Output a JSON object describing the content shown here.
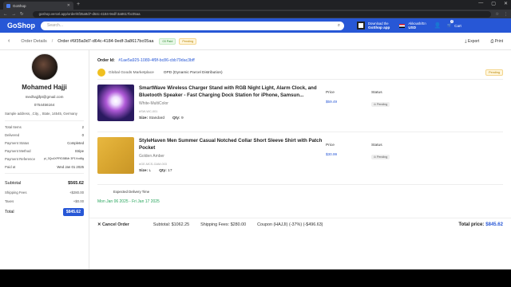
{
  "browser": {
    "tab_title": "GoShop",
    "url": "goshop.vercel.app/order/6f35a9d7-d64c-4184-9edf-3a8617bc05aa"
  },
  "header": {
    "logo": "GoShop",
    "search_placeholder": "Search...",
    "download_title": "Download the",
    "download_sub": "GoShop app",
    "user_line1": "Akkoush/En",
    "user_line2": "USD",
    "cart_count": "0",
    "cart_label": "Cart"
  },
  "orderbar": {
    "crumb_root": "Order Details",
    "crumb_current": "Order #6f35a9d7-d64c-4184-9edf-3a8617bc05aa",
    "paid_badge": "03 Paid",
    "pending_badge": "Pending",
    "export_label": "Export",
    "print_label": "Print"
  },
  "customer": {
    "name": "Mohamed Hajji",
    "email": "medhajjifpt@gmail.com",
    "phone": "0754456164",
    "address": "Sample address, ,City, , State, 14545, Germany"
  },
  "summary": {
    "rows": [
      {
        "k": "Total Items",
        "v": "2"
      },
      {
        "k": "Delivered",
        "v": "0"
      },
      {
        "k": "Payment Status",
        "v": "Completed"
      },
      {
        "k": "Payment Method",
        "v": "Stripe"
      },
      {
        "k": "Payment Reference",
        "v": "pi_3Qc4XPFfD5BMr 3P1Vcd8g"
      },
      {
        "k": "Paid at",
        "v": "Wed Jan 01 2025"
      }
    ],
    "subtotal_label": "Subtotal",
    "subtotal": "$565.62",
    "shipping_label": "Shipping Fees",
    "shipping": "+$280.00",
    "taxes_label": "Taxes",
    "taxes": "+$0.00",
    "total_label": "Total",
    "total": "$845.62"
  },
  "order": {
    "id_label": "Order Id:",
    "id": "#1ae5a925-1089-4f9f-bc86-cbb79dac3bff",
    "seller": "Global Goods Marketplace",
    "shipping_method": "OPD (Dynamic Parcel Distribution)",
    "seller_status": "Pending",
    "price_header": "Price",
    "status_header": "Status",
    "items": [
      {
        "title": "SmartWave Wireless Charger Stand with RGB Night Light, Alarm Clock, and Bluetooth Speaker - Fast Charging Dock Station for iPhone, Samsun...",
        "color": "White-MultiColor",
        "sku": "#SW-WC-001",
        "size_label": "Size:",
        "size": "Standard",
        "qty_label": "Qty:",
        "qty": "9",
        "price": "$59.49",
        "status": "Pending"
      },
      {
        "title": "StyleHaven Men Summer Casual Notched Collar Short Sleeve Shirt with Patch Pocket",
        "color": "Golden Amber",
        "sku": "#GE-MCS-GAM-003",
        "size_label": "Size:",
        "size": "L",
        "qty_label": "Qty:",
        "qty": "17",
        "price": "$30.99",
        "status": "Pending"
      }
    ],
    "delivery_label": "Expected Delivery Time",
    "delivery_range": "Mon Jan 06 2025 - Fri Jan 17 2025"
  },
  "footer": {
    "cancel_label": "Cancel Order",
    "subtotal": "Subtotal: $1062.25",
    "shipping": "Shipping Fees: $280.00",
    "coupon": "Coupon (HAJJI) (-37%) (-$496.63)",
    "total_label": "Total price:",
    "total_value": "$845.62"
  },
  "colors": {
    "brand": "#2757d6",
    "delivery_green": "#27a55c"
  }
}
